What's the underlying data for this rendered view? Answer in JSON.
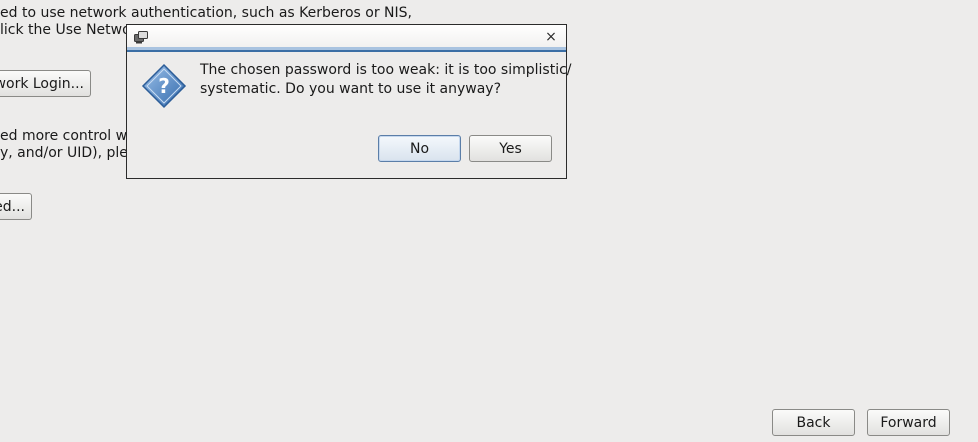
{
  "background": {
    "text_lines": [
      "ed to use network authentication, such as Kerberos or NIS,",
      "lick the Use Netwo",
      "ed more control wh",
      "y, and/or UID), pleas"
    ],
    "network_login_button": "twork Login...",
    "advanced_button": "ed..."
  },
  "dialog": {
    "icon": "question-icon",
    "close_icon": "×",
    "message_lines": [
      "The chosen password is too weak: it is too simplistic/",
      "systematic. Do you want to use it anyway?"
    ],
    "no_label": "No",
    "yes_label": "Yes"
  },
  "footer": {
    "back_label": "Back",
    "forward_label": "Forward"
  },
  "colors": {
    "background": "#edeceb",
    "accent": "#3b6ea5"
  }
}
